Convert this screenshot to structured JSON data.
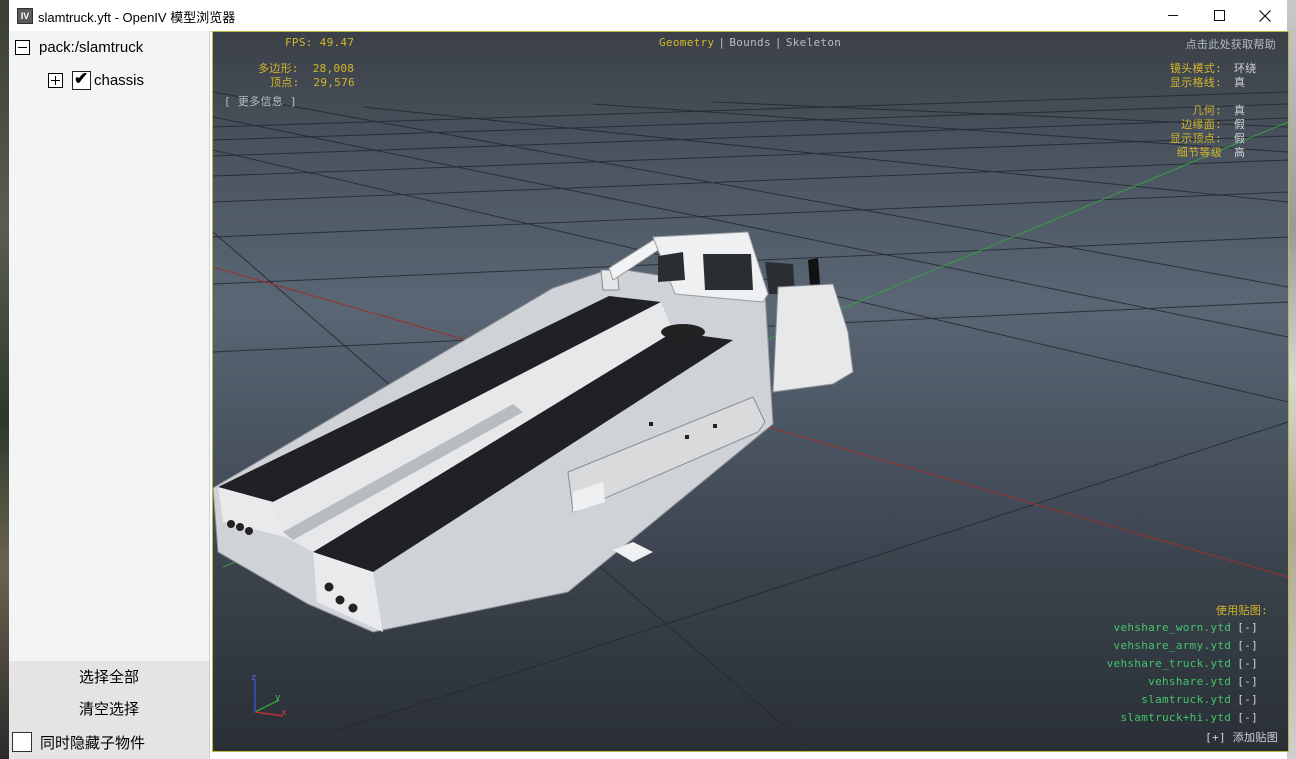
{
  "window": {
    "title": "slamtruck.yft - OpenIV 模型浏览器",
    "app_icon": "IV",
    "controls": [
      "minimize-icon",
      "maximize-icon",
      "close-icon"
    ]
  },
  "tree": {
    "root_label": "pack:/slamtruck",
    "root_expanded": true,
    "child_label": "chassis",
    "child_checked": true
  },
  "sidebar": {
    "select_all": "选择全部",
    "clear_selection": "清空选择",
    "hide_children": "同时隐藏子物件"
  },
  "hud": {
    "fps_label": "FPS:",
    "fps_value": "49.47",
    "polygons_label": "多边形:",
    "polygons_value": "28,008",
    "vertices_label": "顶点:",
    "vertices_value": "29,576",
    "more_info": "[ 更多信息 ]",
    "modes": [
      "Geometry",
      "Bounds",
      "Skeleton"
    ],
    "active_mode": "Geometry",
    "help": "点击此处获取帮助",
    "settings": [
      {
        "label": "镜头模式:",
        "value": "环绕"
      },
      {
        "label": "显示格线:",
        "value": "真"
      },
      {
        "label": "几何:",
        "value": "真"
      },
      {
        "label": "边缘面:",
        "value": "假"
      },
      {
        "label": "显示顶点:",
        "value": "假"
      },
      {
        "label": "细节等级",
        "value": "高"
      }
    ],
    "textures_title": "使用贴图:",
    "textures": [
      "vehshare_worn.ytd",
      "vehshare_army.ytd",
      "vehshare_truck.ytd",
      "vehshare.ytd",
      "slamtruck.ytd",
      "slamtruck+hi.ytd"
    ],
    "remove_label": "[-]",
    "add_texture": "[+] 添加贴图",
    "axis_labels": {
      "z": "z",
      "y": "y",
      "x": "x"
    }
  },
  "colors": {
    "hud_gold": "#d4b62a",
    "hud_green": "#44c46a",
    "axis_x": "#c03030",
    "axis_y": "#30a040",
    "axis_z": "#3050d0"
  }
}
